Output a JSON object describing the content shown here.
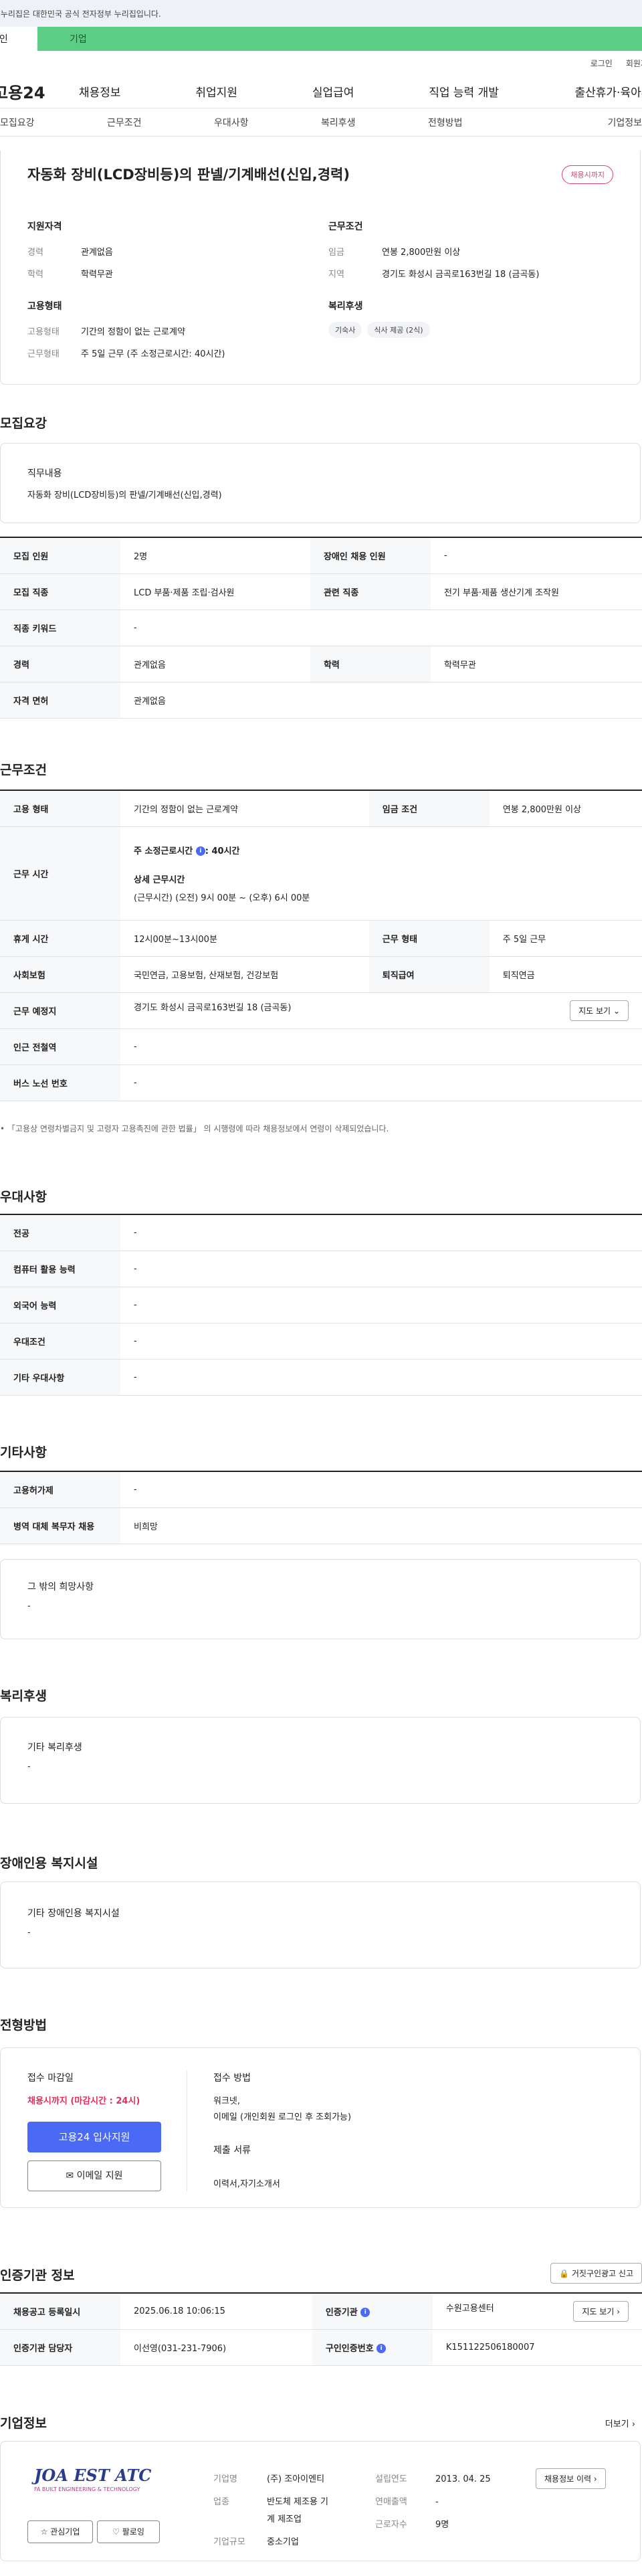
{
  "topbar": {
    "notice": "이 누리집은 대한민국 공식 전자정부 누리집입니다."
  },
  "tabs": {
    "individual": "개인",
    "business": "기업"
  },
  "util": {
    "login": "로그인",
    "join": "회원가입"
  },
  "gnb": {
    "logo": "고용24",
    "items": [
      "채용정보",
      "취업지원",
      "실업급여",
      "직업 능력 개발",
      "출산휴가·육아휴직"
    ]
  },
  "subnav": [
    "모집요강",
    "근무조건",
    "우대사항",
    "복리후생",
    "전형방법",
    "기업정보"
  ],
  "header": {
    "title": "자동화 장비(LCD장비등)의 판넬/기계배선(신입,경력)",
    "badge": "채용시까지",
    "support_title": "지원자격",
    "career_label": "경력",
    "career_value": "관계없음",
    "edu_label": "학력",
    "edu_value": "학력무관",
    "work_title": "근무조건",
    "wage_label": "임금",
    "wage_value": "연봉 2,800만원 이상",
    "region_label": "지역",
    "region_value": "경기도 화성시 금곡로163번길 18 (금곡동)",
    "emp_title": "고용형태",
    "emp_type_label": "고용형태",
    "emp_type_value": "기간의 정함이 없는 근로계약",
    "emp_hours_label": "근무형태",
    "emp_hours_value": "주 5일 근무 (주 소정근로시간: 40시간)",
    "welfare_title": "복리후생",
    "chips": [
      "기숙사",
      "식사 제공 (2식)"
    ]
  },
  "recruit": {
    "title": "모집요강",
    "duty_title": "직무내용",
    "duty_value": "자동화 장비(LCD장비등)의 판넬/기계배선(신입,경력)",
    "rows": [
      {
        "k1": "모집 인원",
        "v1": "2명",
        "k2": "장애인 채용 인원",
        "v2": "-"
      },
      {
        "k1": "모집 직종",
        "v1": "LCD 부품·제품 조립·검사원",
        "k2": "관련 직종",
        "v2": "전기 부품·제품 생산기계 조작원"
      },
      {
        "k1": "직종 키워드",
        "v1": "-"
      },
      {
        "k1": "경력",
        "v1": "관계없음",
        "k2": "학력",
        "v2": "학력무관"
      },
      {
        "k1": "자격 면허",
        "v1": "관계없음"
      }
    ]
  },
  "work": {
    "title": "근무조건",
    "emp_k": "고용 형태",
    "emp_v": "기간의 정함이 없는 근로계약",
    "wage_k": "임금 조건",
    "wage_v": "연봉 2,800만원 이상",
    "time_k": "근무 시간",
    "time_v1": "주 소정근로시간",
    "time_v1b": ": 40시간",
    "time_v2": "상세 근무시간",
    "time_v3": "(근무시간) (오전) 9시 00분 ~ (오후) 6시 00분",
    "break_k": "휴게 시간",
    "break_v": "12시00분~13시00분",
    "form_k": "근무 형태",
    "form_v": "주 5일 근무",
    "ins_k": "사회보험",
    "ins_v": "국민연금, 고용보험, 산재보험, 건강보험",
    "ret_k": "퇴직급여",
    "ret_v": "퇴직연금",
    "place_k": "근무 예정지",
    "place_v": "경기도 화성시 금곡로163번길 18 (금곡동)",
    "map_btn": "지도 보기",
    "station_k": "인근 전철역",
    "station_v": "-",
    "bus_k": "버스 노선 번호",
    "bus_v": "-",
    "note": "「고용상 연령차별금지 및 고령자 고용촉진에 관한 법률」 의 시행령에 따라 채용정보에서 연령이 삭제되었습니다."
  },
  "pref": {
    "title": "우대사항",
    "rows": [
      {
        "k": "전공",
        "v": "-"
      },
      {
        "k": "컴퓨터 활용 능력",
        "v": "-"
      },
      {
        "k": "외국어 능력",
        "v": "-"
      },
      {
        "k": "우대조건",
        "v": "-"
      },
      {
        "k": "기타 우대사항",
        "v": "-"
      }
    ]
  },
  "etc": {
    "title": "기타사항",
    "rows": [
      {
        "k": "고용허가제",
        "v": "-"
      },
      {
        "k": "병역 대체 복무자 채용",
        "v": "비희망"
      }
    ],
    "wish_title": "그 밖의 희망사항",
    "wish_value": "-"
  },
  "welfare": {
    "title": "복리후생",
    "box_title": "기타 복리후생",
    "box_value": "-"
  },
  "disab": {
    "title": "장애인용 복지시설",
    "box_title": "기타 장애인용 복지시설",
    "box_value": "-"
  },
  "process": {
    "title": "전형방법",
    "deadline_label": "접수 마감일",
    "deadline_value": "채용시까지 (마감시간 : 24시)",
    "apply_btn": "고용24 입사지원",
    "email_btn": "이메일 지원",
    "method_label": "접수 방법",
    "method_value1": "워크넷,",
    "method_value2": "이메일 (개인회원 로그인 후 조회가능)",
    "docs_label": "제출 서류",
    "docs_value": "이력서,자기소개서"
  },
  "auth": {
    "title": "인증기관 정보",
    "report_btn": "거짓구인광고 신고",
    "reg_k": "채용공고 등록일시",
    "reg_v": "2025.06.18 10:06:15",
    "org_k": "인증기관",
    "org_v": "수원고용센터",
    "map_btn": "지도 보기",
    "mgr_k": "인증기관 담당자",
    "mgr_v": "이선영(031-231-7906)",
    "auth_k": "구인인증번호",
    "auth_v": "K151122506180007"
  },
  "company": {
    "title": "기업정보",
    "more": "더보기",
    "logo_text": "JOA EST ATC",
    "logo_sub": "FA BUILT ENGINEERING & TECHNOLOGY",
    "fav": "관심기업",
    "follow": "팔로잉",
    "name_k": "기업명",
    "name_v": "(주) 조아이엔티",
    "ind_k": "업종",
    "ind_v1": "반도체 제조용 기",
    "ind_v2": "계 제조업",
    "size_k": "기업규모",
    "size_v": "중소기업",
    "year_k": "설립연도",
    "year_v": "2013. 04. 25",
    "sales_k": "연매출액",
    "sales_v": "-",
    "emp_k": "근로자수",
    "emp_v": "9명",
    "history_btn": "채용정보 이력"
  }
}
